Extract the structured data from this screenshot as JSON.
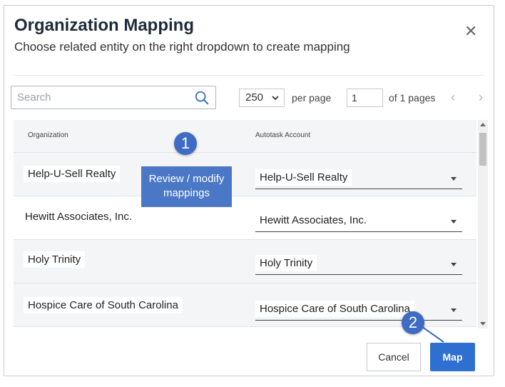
{
  "dialog": {
    "title": "Organization Mapping",
    "subtitle": "Choose related entity on the right dropdown to create mapping",
    "close_icon": "close-icon"
  },
  "toolbar": {
    "search_placeholder": "Search",
    "search_icon": "search-icon",
    "per_page_value": "250",
    "per_page_label": "per page",
    "page_value": "1",
    "page_total_label": "of 1 pages",
    "prev_icon": "chevron-left-icon",
    "next_icon": "chevron-right-icon"
  },
  "table": {
    "columns": [
      "Organization",
      "Autotask Account"
    ],
    "rows": [
      {
        "organization": "Help-U-Sell Realty",
        "account": "Help-U-Sell Realty"
      },
      {
        "organization": "Hewitt Associates, Inc.",
        "account": "Hewitt Associates, Inc."
      },
      {
        "organization": "Holy Trinity",
        "account": "Holy Trinity"
      },
      {
        "organization": "Hospice Care of South Carolina",
        "account": "Hospice Care of South Carolina"
      }
    ]
  },
  "annotations": {
    "callout_text": "Review / modify mappings",
    "badge_1": "1",
    "badge_2": "2"
  },
  "footer": {
    "cancel_label": "Cancel",
    "map_label": "Map"
  },
  "colors": {
    "accent": "#2e6fd0",
    "callout": "#4a78c7",
    "badge": "#3e6cc4"
  }
}
